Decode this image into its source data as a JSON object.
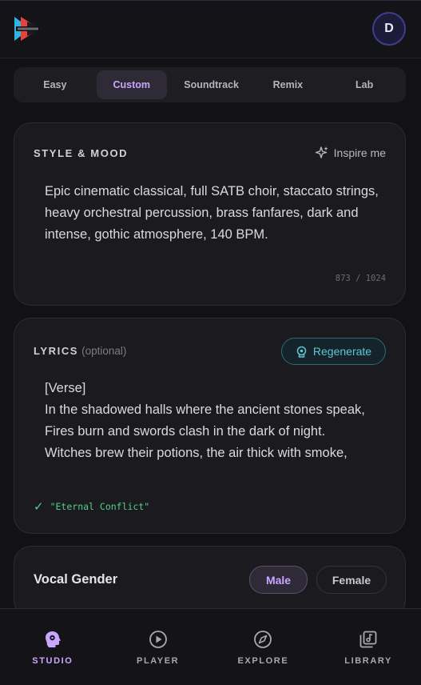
{
  "header": {
    "logo_icon": "app-logo-icon",
    "avatar_letter": "D",
    "accent_color": "#c9a6ff"
  },
  "tabs": [
    {
      "label": "Easy",
      "active": false
    },
    {
      "label": "Custom",
      "active": true
    },
    {
      "label": "Soundtrack",
      "active": false
    },
    {
      "label": "Remix",
      "active": false
    },
    {
      "label": "Lab",
      "active": false
    }
  ],
  "style_card": {
    "title": "STYLE & MOOD",
    "inspire_label": "Inspire me",
    "text": "Epic cinematic classical, full SATB choir, staccato strings, heavy orchestral percussion, brass fanfares, dark and intense, gothic atmosphere, 140 BPM.",
    "counter": "873 / 1024"
  },
  "lyrics_card": {
    "title": "LYRICS",
    "optional": "(optional)",
    "regenerate_label": "Regenerate",
    "lines": [
      "[Verse]",
      "In the shadowed halls where the ancient stones speak,",
      "Fires burn and swords clash in the dark of night.",
      "Witches brew their potions, the air thick with smoke,"
    ],
    "song_title": "\"Eternal Conflict\"",
    "song_title_color": "#4fd08a"
  },
  "vocal_card": {
    "label": "Vocal Gender",
    "options": [
      "Male",
      "Female"
    ],
    "selected": "Male"
  },
  "bottom_nav": [
    {
      "label": "STUDIO",
      "icon": "studio-icon",
      "active": true
    },
    {
      "label": "PLAYER",
      "icon": "play-circle-icon",
      "active": false
    },
    {
      "label": "EXPLORE",
      "icon": "compass-icon",
      "active": false
    },
    {
      "label": "LIBRARY",
      "icon": "library-icon",
      "active": false
    }
  ]
}
